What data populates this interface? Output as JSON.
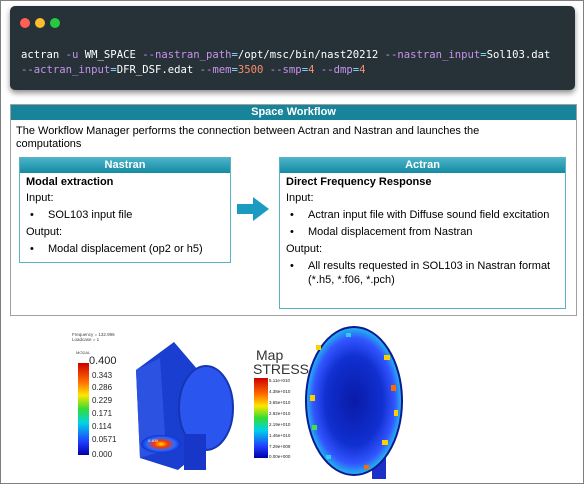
{
  "terminal": {
    "line1": {
      "cmd": "actran ",
      "flag1": "-u",
      "arg1": " WM_SPACE ",
      "flag2": "--nastran_path",
      "eq1": "=",
      "val2": "/opt/msc/bin/nast20212 ",
      "flag3": "--nastran_input",
      "eq2": "=",
      "val3": "Sol103.dat"
    },
    "line2": {
      "flag4": "--actran_input",
      "eq3": "=",
      "val4": "DFR_DSF.edat ",
      "flag5": "--mem",
      "eq4": "=",
      "val5": "3500",
      "sp1": " ",
      "flag6": "--smp",
      "eq5": "=",
      "val6": "4",
      "sp2": " ",
      "flag7": "--dmp",
      "eq6": "=",
      "val7": "4"
    },
    "colors": {
      "background": "#263238",
      "flag": "#c792ea",
      "operator": "#89ddff",
      "number": "#f78c6c",
      "text": "#ffffff"
    }
  },
  "workflow": {
    "title": "Space Workflow",
    "description": "The Workflow Manager performs the connection between Actran and Nastran and launches the computations",
    "header_color": "#17849a",
    "nastran": {
      "header": "Nastran",
      "title": "Modal extraction",
      "input_label": "Input:",
      "inputs": [
        "SOL103 input file"
      ],
      "output_label": "Output:",
      "outputs": [
        "Modal displacement (op2 or h5)"
      ]
    },
    "actran": {
      "header": "Actran",
      "title": "Direct Frequency Response",
      "input_label": "Input:",
      "inputs": [
        "Actran input file with Diffuse sound field excitation",
        "Modal displacement from Nastran"
      ],
      "output_label": "Output:",
      "outputs": [
        "All results requested in SOL103 in Nastran format (*.h5, *.f06, *.pch)"
      ]
    },
    "arrow_icon": "right-arrow-icon",
    "bullet": "•"
  },
  "results": {
    "modal": {
      "header_line1": "Frequency = 132.996",
      "header_line2": "Loadcase = 1",
      "legend_title": "MODAL",
      "legend_max": "0.400",
      "ticks": [
        "0.343",
        "0.286",
        "0.229",
        "0.171",
        "0.114",
        "0.0571",
        "0.000"
      ],
      "max_marker": "0.400"
    },
    "stress": {
      "title_line1": "Map",
      "title_line2": "STRESS",
      "ticks": [
        "5.11e+010",
        "4.38e+010",
        "3.65e+010",
        "2.92e+010",
        "2.19e+010",
        "1.46e+010",
        "7.29e+009",
        "0.00e+000"
      ]
    }
  }
}
